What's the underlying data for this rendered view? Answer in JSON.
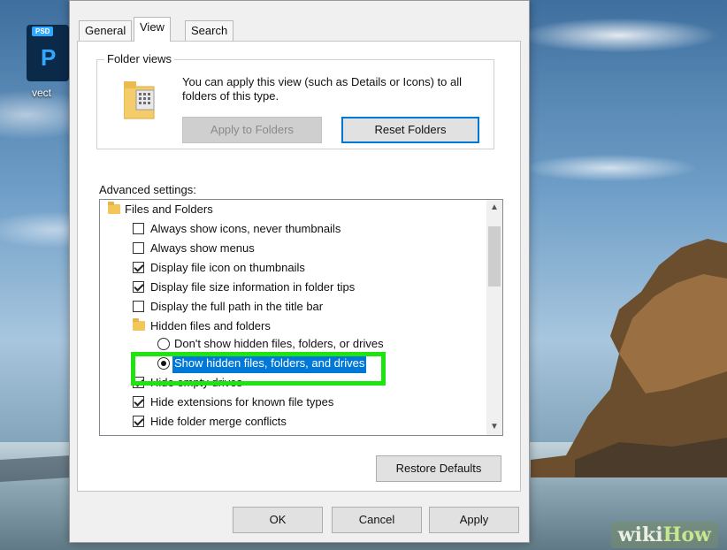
{
  "desktop": {
    "psd_badge": "PSD",
    "psd_letter": "P",
    "icon_label": "vect",
    "watermark_wiki": "wiki",
    "watermark_how": "How"
  },
  "dialog": {
    "tabs": [
      {
        "label": "General",
        "active": false
      },
      {
        "label": "View",
        "active": true
      },
      {
        "label": "Search",
        "active": false
      }
    ],
    "folder_views": {
      "title": "Folder views",
      "description": "You can apply this view (such as Details or Icons) to all folders of this type.",
      "apply_label": "Apply to Folders",
      "reset_label": "Reset Folders"
    },
    "advanced_label": "Advanced settings:",
    "tree_items": [
      {
        "type": "folder",
        "label": "Files and Folders"
      },
      {
        "type": "checkbox",
        "checked": false,
        "label": "Always show icons, never thumbnails"
      },
      {
        "type": "checkbox",
        "checked": false,
        "label": "Always show menus"
      },
      {
        "type": "checkbox",
        "checked": true,
        "label": "Display file icon on thumbnails"
      },
      {
        "type": "checkbox",
        "checked": true,
        "label": "Display file size information in folder tips"
      },
      {
        "type": "checkbox",
        "checked": false,
        "label": "Display the full path in the title bar"
      },
      {
        "type": "folder",
        "label": "Hidden files and folders"
      },
      {
        "type": "radio",
        "checked": false,
        "label": "Don't show hidden files, folders, or drives"
      },
      {
        "type": "radio",
        "checked": true,
        "selected": true,
        "label": "Show hidden files, folders, and drives"
      },
      {
        "type": "checkbox",
        "checked": true,
        "label": "Hide empty drives"
      },
      {
        "type": "checkbox",
        "checked": true,
        "label": "Hide extensions for known file types"
      },
      {
        "type": "checkbox",
        "checked": true,
        "label": "Hide folder merge conflicts"
      }
    ],
    "restore_label": "Restore Defaults",
    "ok_label": "OK",
    "cancel_label": "Cancel",
    "apply_label": "Apply"
  },
  "colors": {
    "selection": "#0078d7",
    "highlight_box": "#1ee50f"
  },
  "icons": {
    "scroll_up": "chevron-up-icon",
    "scroll_down": "chevron-down-icon",
    "folder": "folder-icon"
  }
}
